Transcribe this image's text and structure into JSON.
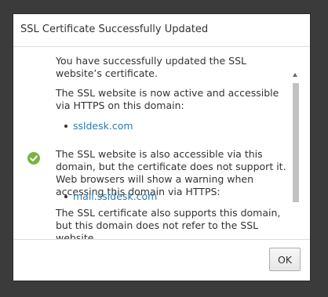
{
  "dialog": {
    "title": "SSL Certificate Successfully Updated",
    "status_icon": "check-circle-icon",
    "accent_color": "#7cb342",
    "link_color": "#2a7ab0",
    "paragraphs": {
      "p1": "You have successfully updated the SSL website’s certificate.",
      "p2": "The SSL website is now active and accessible via HTTPS on this domain:",
      "p3": "The SSL website is also accessible via this domain, but the certificate does not support it. Web browsers will show a warning when accessing this domain via HTTPS:",
      "p4": "The SSL certificate also supports this domain, but this domain does not refer to the SSL website."
    },
    "links": {
      "primary_domain": "ssldesk.com",
      "secondary_domain": "mail.ssldesk.com"
    },
    "ok_label": "OK"
  }
}
